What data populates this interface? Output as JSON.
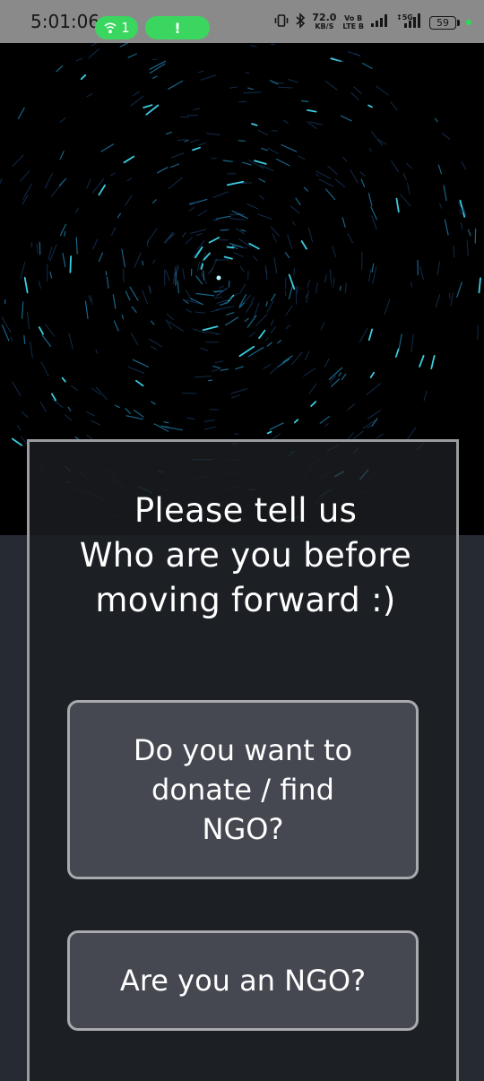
{
  "status_bar": {
    "time": "5:01:06",
    "hotspot_count": "1",
    "alert": "!",
    "speed_value": "72.0",
    "speed_unit": "KB/S",
    "volte_top": "Vo B",
    "volte_bottom": "LTE B",
    "network_5g": "5G",
    "battery": "59"
  },
  "prompt": {
    "line1": "Please tell us",
    "line2": "Who are you before",
    "line3": "moving forward :)"
  },
  "choices": {
    "donor_line1": "Do you want to",
    "donor_line2": "donate / find",
    "donor_line3": "NGO?",
    "ngo_label": "Are you an NGO?"
  },
  "colors": {
    "accent_green": "#3bd65f",
    "star_cyan": "#3fd8ec",
    "card_border": "#9a9c9f",
    "button_bg": "#454851"
  },
  "icons": [
    "hotspot-icon",
    "vibrate-icon",
    "bluetooth-icon",
    "signal-icon",
    "battery-icon"
  ]
}
